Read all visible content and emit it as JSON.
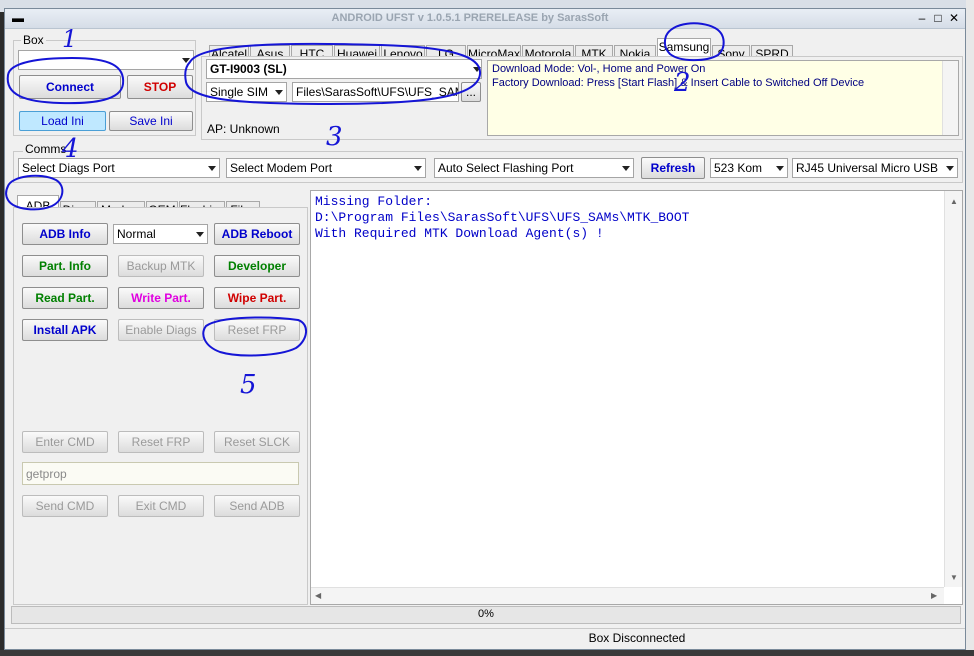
{
  "window": {
    "title": "ANDROID UFST v 1.0.5.1 PRERELEASE by SarasSoft"
  },
  "box": {
    "label": "Box",
    "connect": "Connect",
    "stop": "STOP",
    "load_ini": "Load Ini",
    "save_ini": "Save Ini"
  },
  "brand_tabs": [
    "Alcatel",
    "Asus",
    "HTC",
    "Huawei",
    "Lenovo",
    "LG",
    "MicroMax",
    "Motorola",
    "MTK",
    "Nokia",
    "Samsung",
    "Sony",
    "SPRD"
  ],
  "model": {
    "selected": "GT-I9003 (SL)",
    "sim": "Single SIM",
    "path": "Files\\SarasSoft\\UFS\\UFS_SAMs",
    "browse": "...",
    "ap": "AP: Unknown"
  },
  "info": {
    "line1": "Download Mode: Vol-, Home and Power On",
    "line2": "Factory Download: Press [Start Flash] & Insert Cable to Switched Off Device"
  },
  "comms": {
    "label": "Comms",
    "diag_port": "Select Diags Port",
    "modem_port": "Select Modem Port",
    "flash_port": "Auto Select Flashing Port",
    "refresh": "Refresh",
    "speed": "523 Kom",
    "cable": "RJ45 Universal Micro USB"
  },
  "func_tabs": [
    "ADB",
    "Diags",
    "Modem",
    "OEM",
    "Flashing",
    "Files"
  ],
  "adb": {
    "adb_info": "ADB Info",
    "mode": "Normal",
    "adb_reboot": "ADB Reboot",
    "part_info": "Part. Info",
    "backup_mtk": "Backup MTK",
    "developer": "Developer",
    "read_part": "Read Part.",
    "write_part": "Write Part.",
    "wipe_part": "Wipe Part.",
    "install_apk": "Install APK",
    "enable_diags": "Enable Diags",
    "reset_frp": "Reset FRP",
    "enter_cmd": "Enter CMD",
    "reset_frp2": "Reset FRP",
    "reset_slck": "Reset SLCK",
    "cmd_value": "getprop",
    "send_cmd": "Send CMD",
    "exit_cmd": "Exit CMD",
    "send_adb": "Send ADB"
  },
  "log": {
    "line1": "Missing Folder:",
    "line2": "D:\\Program Files\\SarasSoft\\UFS\\UFS_SAMs\\MTK_BOOT",
    "line3": "With Required MTK Download Agent(s) !"
  },
  "progress": {
    "text": "0%",
    "value": 0
  },
  "status": {
    "text": "Box Disconnected"
  },
  "annotations": [
    "1",
    "2",
    "3",
    "4",
    "5"
  ],
  "colors": {
    "green": "#008000",
    "blue": "#0000cc",
    "red": "#d00000",
    "magenta": "#e000e0",
    "ink": "#1515d6"
  }
}
